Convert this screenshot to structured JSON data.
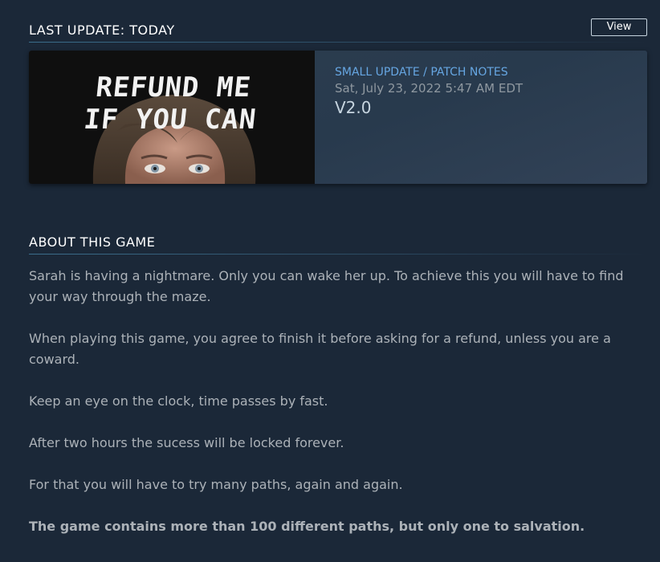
{
  "last_update": {
    "header": "LAST UPDATE: TODAY",
    "view_button_label": "View",
    "card": {
      "image_title_line1": "REFUND ME",
      "image_title_line2": "IF YOU CAN",
      "type": "SMALL UPDATE / PATCH NOTES",
      "date": "Sat, July 23, 2022 5:47 AM EDT",
      "version": "V2.0"
    }
  },
  "about": {
    "header": "ABOUT THIS GAME",
    "paragraphs": [
      "Sarah is having a nightmare. Only you can wake her up. To achieve this you will have to find your way through the maze.",
      "When playing this game, you agree to finish it before asking for a refund, unless you are a coward.",
      "Keep an eye on the clock, time passes by fast.",
      "After two hours the sucess will be locked forever.",
      "For that you will have to try many paths, again and again.",
      "The game contains more than 100 different paths, but only one to salvation."
    ]
  },
  "colors": {
    "background": "#1b2838",
    "link_blue": "#66a6e2",
    "header_text": "#ffffff",
    "body_text": "#acb2b8"
  }
}
